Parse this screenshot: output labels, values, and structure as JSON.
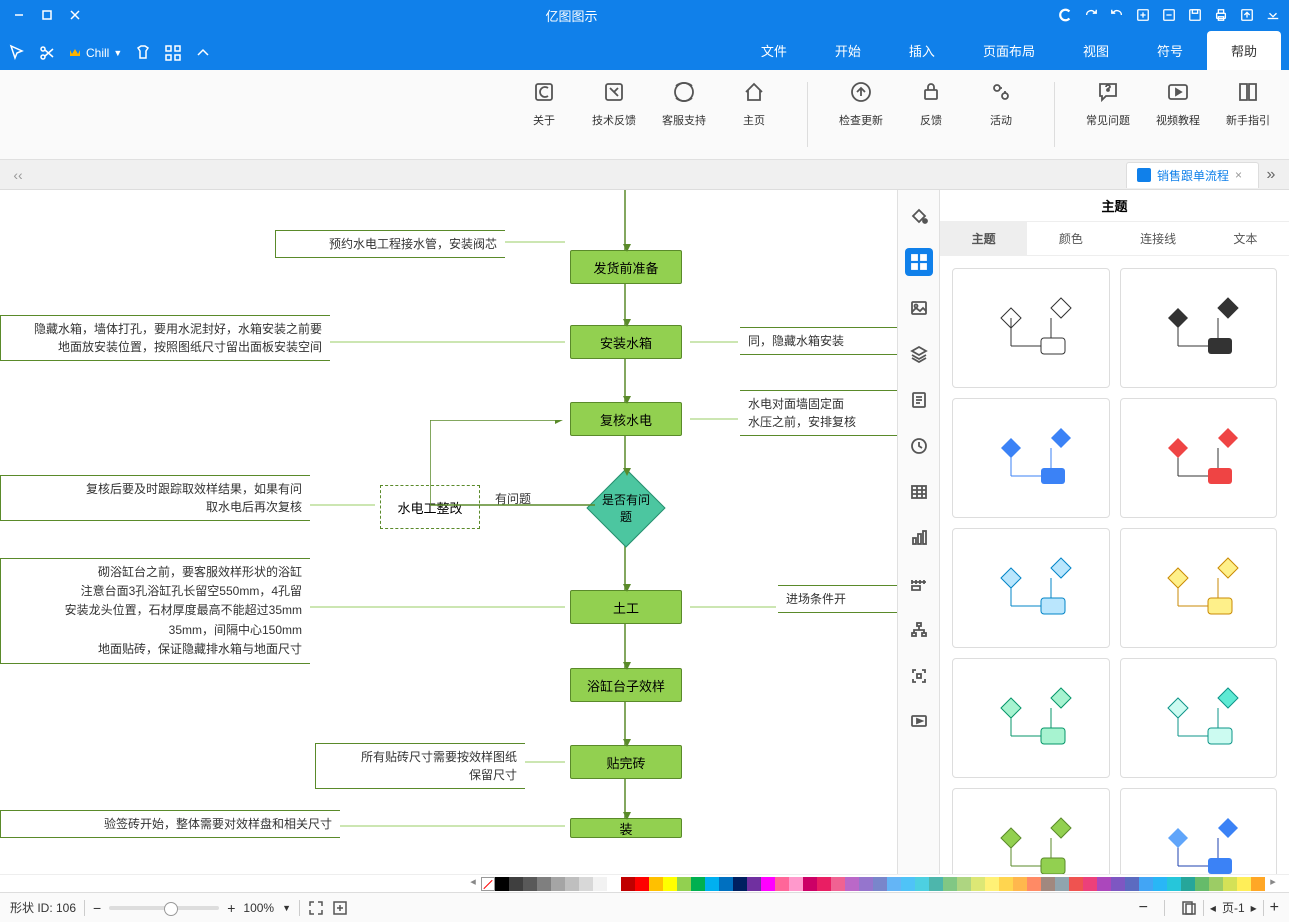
{
  "app": {
    "title": "亿图图示"
  },
  "menus": [
    "文件",
    "开始",
    "插入",
    "页面布局",
    "视图",
    "符号",
    "帮助"
  ],
  "ribbon": {
    "items": [
      {
        "label": "新手指引"
      },
      {
        "label": "视频教程"
      },
      {
        "label": "常见问题"
      },
      {
        "label": "活动"
      },
      {
        "label": "反馈"
      },
      {
        "label": "检查更新"
      },
      {
        "label": "主页"
      },
      {
        "label": "客服支持"
      },
      {
        "label": "技术反馈"
      },
      {
        "label": "关于"
      }
    ]
  },
  "docTab": {
    "title": "销售跟单流程",
    "close": "×"
  },
  "sidepanel": {
    "title": "主题",
    "tabs": [
      "主题",
      "颜色",
      "连接线",
      "文本"
    ]
  },
  "flow": {
    "n1": "发货前准备",
    "n1note": "预约水电工程接水管，安装阀芯",
    "n2": "安装水箱",
    "n2noteR": "隐藏水箱，墙体打孔，要用水泥封好，水箱安装之前要",
    "n2noteR2": "地面放安装位置，按照图纸尺寸留出面板安装空间",
    "n2noteL": "同，隐藏水箱安装",
    "n3": "复核水电",
    "n3noteL": "水电对面墙固定面",
    "n3noteL2": "水压之前，安排复核",
    "d1": "是否有问题",
    "d1L": "有问题",
    "d1box": "水电工整改",
    "d1note": "复核后要及时跟踪取效样结果，如果有问",
    "d1note2": "取水电后再次复核",
    "n4": "土工",
    "n4noteL": "进场条件开",
    "n4noteR": "砌浴缸台之前，要客服效样形状的浴缸",
    "n4noteR2": "注意台面3孔浴缸孔长留空550mm，4孔留",
    "n4noteR3": "安装龙头位置，石材厚度最高不能超过35mm",
    "n4noteR4": "35mm，间隔中心150mm",
    "n4noteR5": "地面贴砖，保证隐藏排水箱与地面尺寸",
    "n5": "浴缸台子效样",
    "n6": "贴完砖",
    "n6note": "所有贴砖尺寸需要按效样图纸",
    "n6note2": "保留尺寸",
    "n7": "装",
    "n7note": "验签砖开始，整体需要对效样盘和相关尺寸"
  },
  "statusbar": {
    "page": "页-1",
    "shapeId": "形状 ID: 106",
    "zoom": "100%"
  },
  "chill": "Chill",
  "colors": [
    "#000",
    "#3f3f3f",
    "#595959",
    "#7f7f7f",
    "#a5a5a5",
    "#bfbfbf",
    "#d8d8d8",
    "#f2f2f2",
    "#fff",
    "#c00000",
    "#ff0000",
    "#ffc000",
    "#ffff00",
    "#92d050",
    "#00b050",
    "#00b0f0",
    "#0070c0",
    "#002060",
    "#7030a0",
    "#ff00ff",
    "#ff6699",
    "#ff99cc",
    "#cc0066",
    "#e91e63",
    "#f06292",
    "#ba68c8",
    "#9575cd",
    "#7986cb",
    "#64b5f6",
    "#4fc3f7",
    "#4dd0e1",
    "#4db6ac",
    "#81c784",
    "#aed581",
    "#dce775",
    "#fff176",
    "#ffd54f",
    "#ffb74d",
    "#ff8a65",
    "#a1887f",
    "#90a4ae",
    "#ef5350",
    "#ec407a",
    "#ab47bc",
    "#7e57c2",
    "#5c6bc0",
    "#42a5f5",
    "#29b6f6",
    "#26c6da",
    "#26a69a",
    "#66bb6a",
    "#9ccc65",
    "#d4e157",
    "#ffee58",
    "#ffa726"
  ]
}
